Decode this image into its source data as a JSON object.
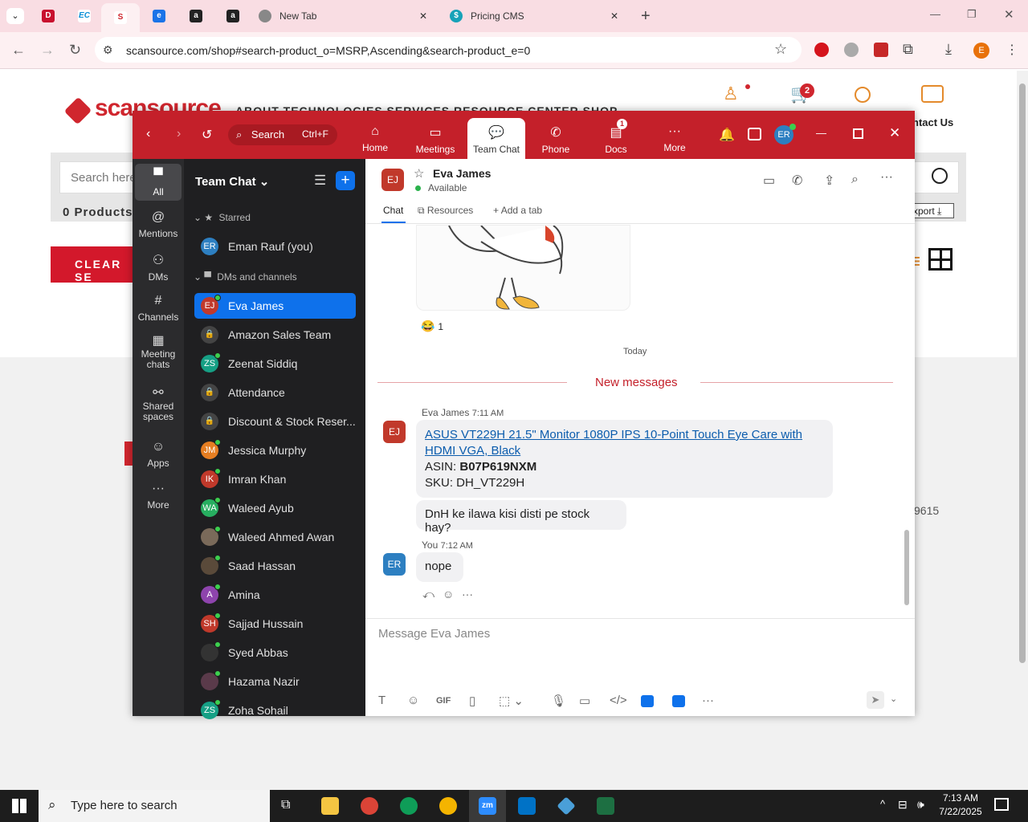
{
  "browser": {
    "tabs": [
      {
        "label": "",
        "icon": "dell-icon"
      },
      {
        "label": "",
        "icon": "ec-icon"
      },
      {
        "label": "",
        "icon": "scansource-icon"
      },
      {
        "label": "",
        "icon": "edge-icon"
      },
      {
        "label": "",
        "icon": "amazon-icon"
      },
      {
        "label": "",
        "icon": "amazon-icon"
      },
      {
        "label": "New Tab",
        "icon": "chrome-icon"
      },
      {
        "label": "Pricing CMS",
        "icon": "dollar-icon"
      }
    ],
    "url": "scansource.com/shop#search-product_o=MSRP,Ascending&search-product_e=0",
    "profile_initial": "E"
  },
  "website": {
    "logo": "scansource",
    "nav": "ABOUT   TECHNOLOGIES   SERVICES   RESOURCE CENTER   SHOP",
    "contact": "ntact Us",
    "cart_count": "2",
    "search_placeholder": "Search here",
    "products_count": "0 Products",
    "clear_label": "CLEAR SE",
    "export_label": "xport",
    "side_number": "9615"
  },
  "zoom": {
    "search_label": "Search",
    "search_shortcut": "Ctrl+F",
    "tabs": [
      {
        "label": "Home",
        "icon": "home-icon"
      },
      {
        "label": "Meetings",
        "icon": "camera-icon"
      },
      {
        "label": "Team Chat",
        "icon": "chat-icon"
      },
      {
        "label": "Phone",
        "icon": "phone-icon"
      },
      {
        "label": "Docs",
        "icon": "docs-icon"
      },
      {
        "label": "More",
        "icon": "more-icon"
      }
    ],
    "docs_badge": "1",
    "user_initials": "ER",
    "rail": [
      {
        "label": "All",
        "icon": "chat-bubble-icon"
      },
      {
        "label": "Mentions",
        "icon": "at-icon"
      },
      {
        "label": "DMs",
        "icon": "people-icon"
      },
      {
        "label": "Channels",
        "icon": "hash-icon"
      },
      {
        "label": "Meeting chats",
        "icon": "calendar-icon"
      },
      {
        "label": "Shared spaces",
        "icon": "share-icon"
      },
      {
        "label": "Apps",
        "icon": "apps-icon"
      },
      {
        "label": "More",
        "icon": "more-icon"
      }
    ],
    "sidebar": {
      "title": "Team Chat",
      "starred_label": "Starred",
      "dms_label": "DMs and channels",
      "starred": [
        {
          "name": "Eman Rauf (you)",
          "initials": "ER",
          "color": "#2d7fc1"
        }
      ],
      "items": [
        {
          "name": "Eva James",
          "initials": "EJ",
          "color": "#c1392b",
          "online": true
        },
        {
          "name": "Amazon Sales Team",
          "initials": "",
          "color": "#444",
          "online": false
        },
        {
          "name": "Zeenat Siddiq",
          "initials": "ZS",
          "color": "#16a085",
          "online": true
        },
        {
          "name": "Attendance",
          "initials": "",
          "color": "#444",
          "online": false
        },
        {
          "name": "Discount & Stock Reser...",
          "initials": "",
          "color": "#444",
          "online": false
        },
        {
          "name": "Jessica Murphy",
          "initials": "JM",
          "color": "#e67e22",
          "online": true
        },
        {
          "name": "Imran Khan",
          "initials": "IK",
          "color": "#c0392b",
          "online": true
        },
        {
          "name": "Waleed Ayub",
          "initials": "WA",
          "color": "#27ae60",
          "online": true
        },
        {
          "name": "Waleed Ahmed Awan",
          "initials": "",
          "color": "#7a6a5a",
          "online": true
        },
        {
          "name": "Saad Hassan",
          "initials": "",
          "color": "#5a4a3a",
          "online": true
        },
        {
          "name": "Amina",
          "initials": "A",
          "color": "#8e44ad",
          "online": true
        },
        {
          "name": "Sajjad Hussain",
          "initials": "SH",
          "color": "#c0392b",
          "online": true
        },
        {
          "name": "Syed Abbas",
          "initials": "",
          "color": "#333",
          "online": true
        },
        {
          "name": "Hazama Nazir",
          "initials": "",
          "color": "#5a3a4a",
          "online": true
        },
        {
          "name": "Zoha Sohail",
          "initials": "ZS",
          "color": "#16a085",
          "online": true
        }
      ]
    },
    "chat": {
      "contact_name": "Eva James",
      "contact_initials": "EJ",
      "status": "Available",
      "tab_chat": "Chat",
      "tab_resources": "Resources",
      "tab_add": "Add a tab",
      "reaction_emoji": "😂",
      "reaction_count": "1",
      "date_divider": "Today",
      "new_messages": "New messages",
      "msg1_sender": "Eva James",
      "msg1_time": "7:11 AM",
      "msg1_link": "ASUS VT229H 21.5\" Monitor 1080P IPS 10-Point Touch Eye Care with HDMI VGA, Black",
      "msg1_asin_label": "ASIN: ",
      "msg1_asin": "B07P619NXM",
      "msg1_sku": "SKU: DH_VT229H",
      "msg2": "DnH ke ilawa kisi disti pe stock hay?",
      "msg3_sender": "You",
      "msg3_time": "7:12 AM",
      "msg3_initials": "ER",
      "msg3": "nope",
      "composer_placeholder": "Message Eva James"
    }
  },
  "taskbar": {
    "search_placeholder": "Type here to search",
    "time": "7:13 AM",
    "date": "7/22/2025"
  }
}
